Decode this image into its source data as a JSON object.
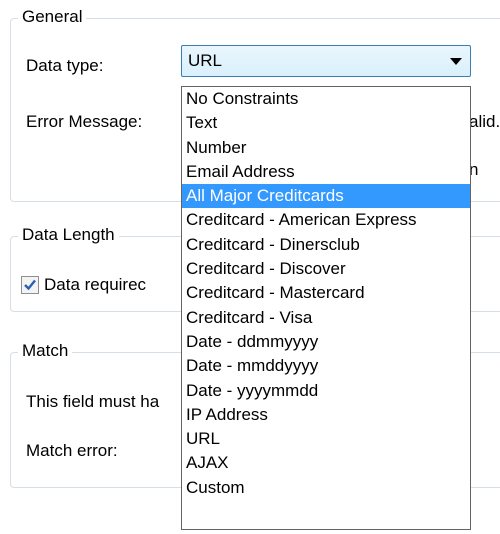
{
  "general": {
    "title": "General",
    "data_type_label": "Data type:",
    "data_type_value": "URL",
    "error_message_label": "Error Message:",
    "error_message_value_fragment": "alid.",
    "second_line_fragment": "n"
  },
  "data_length": {
    "title": "Data Length",
    "data_required_label": "Data requirec",
    "data_required_checked": true
  },
  "match": {
    "title": "Match",
    "must_have_label": "This field must ha",
    "match_error_label": "Match error:"
  },
  "dropdown": {
    "selected_index": 4,
    "options": [
      "No Constraints",
      "Text",
      "Number",
      "Email Address",
      "All Major Creditcards",
      "Creditcard - American Express",
      "Creditcard - Dinersclub",
      "Creditcard - Discover",
      "Creditcard - Mastercard",
      "Creditcard - Visa",
      "Date - ddmmyyyy",
      "Date - mmddyyyy",
      "Date - yyyymmdd",
      "IP Address",
      "URL",
      "AJAX",
      "Custom"
    ]
  },
  "colors": {
    "highlight": "#3399ff",
    "group_border": "#d5dfe5",
    "combo_border": "#3c7fb1",
    "check": "#2a5fb2"
  }
}
